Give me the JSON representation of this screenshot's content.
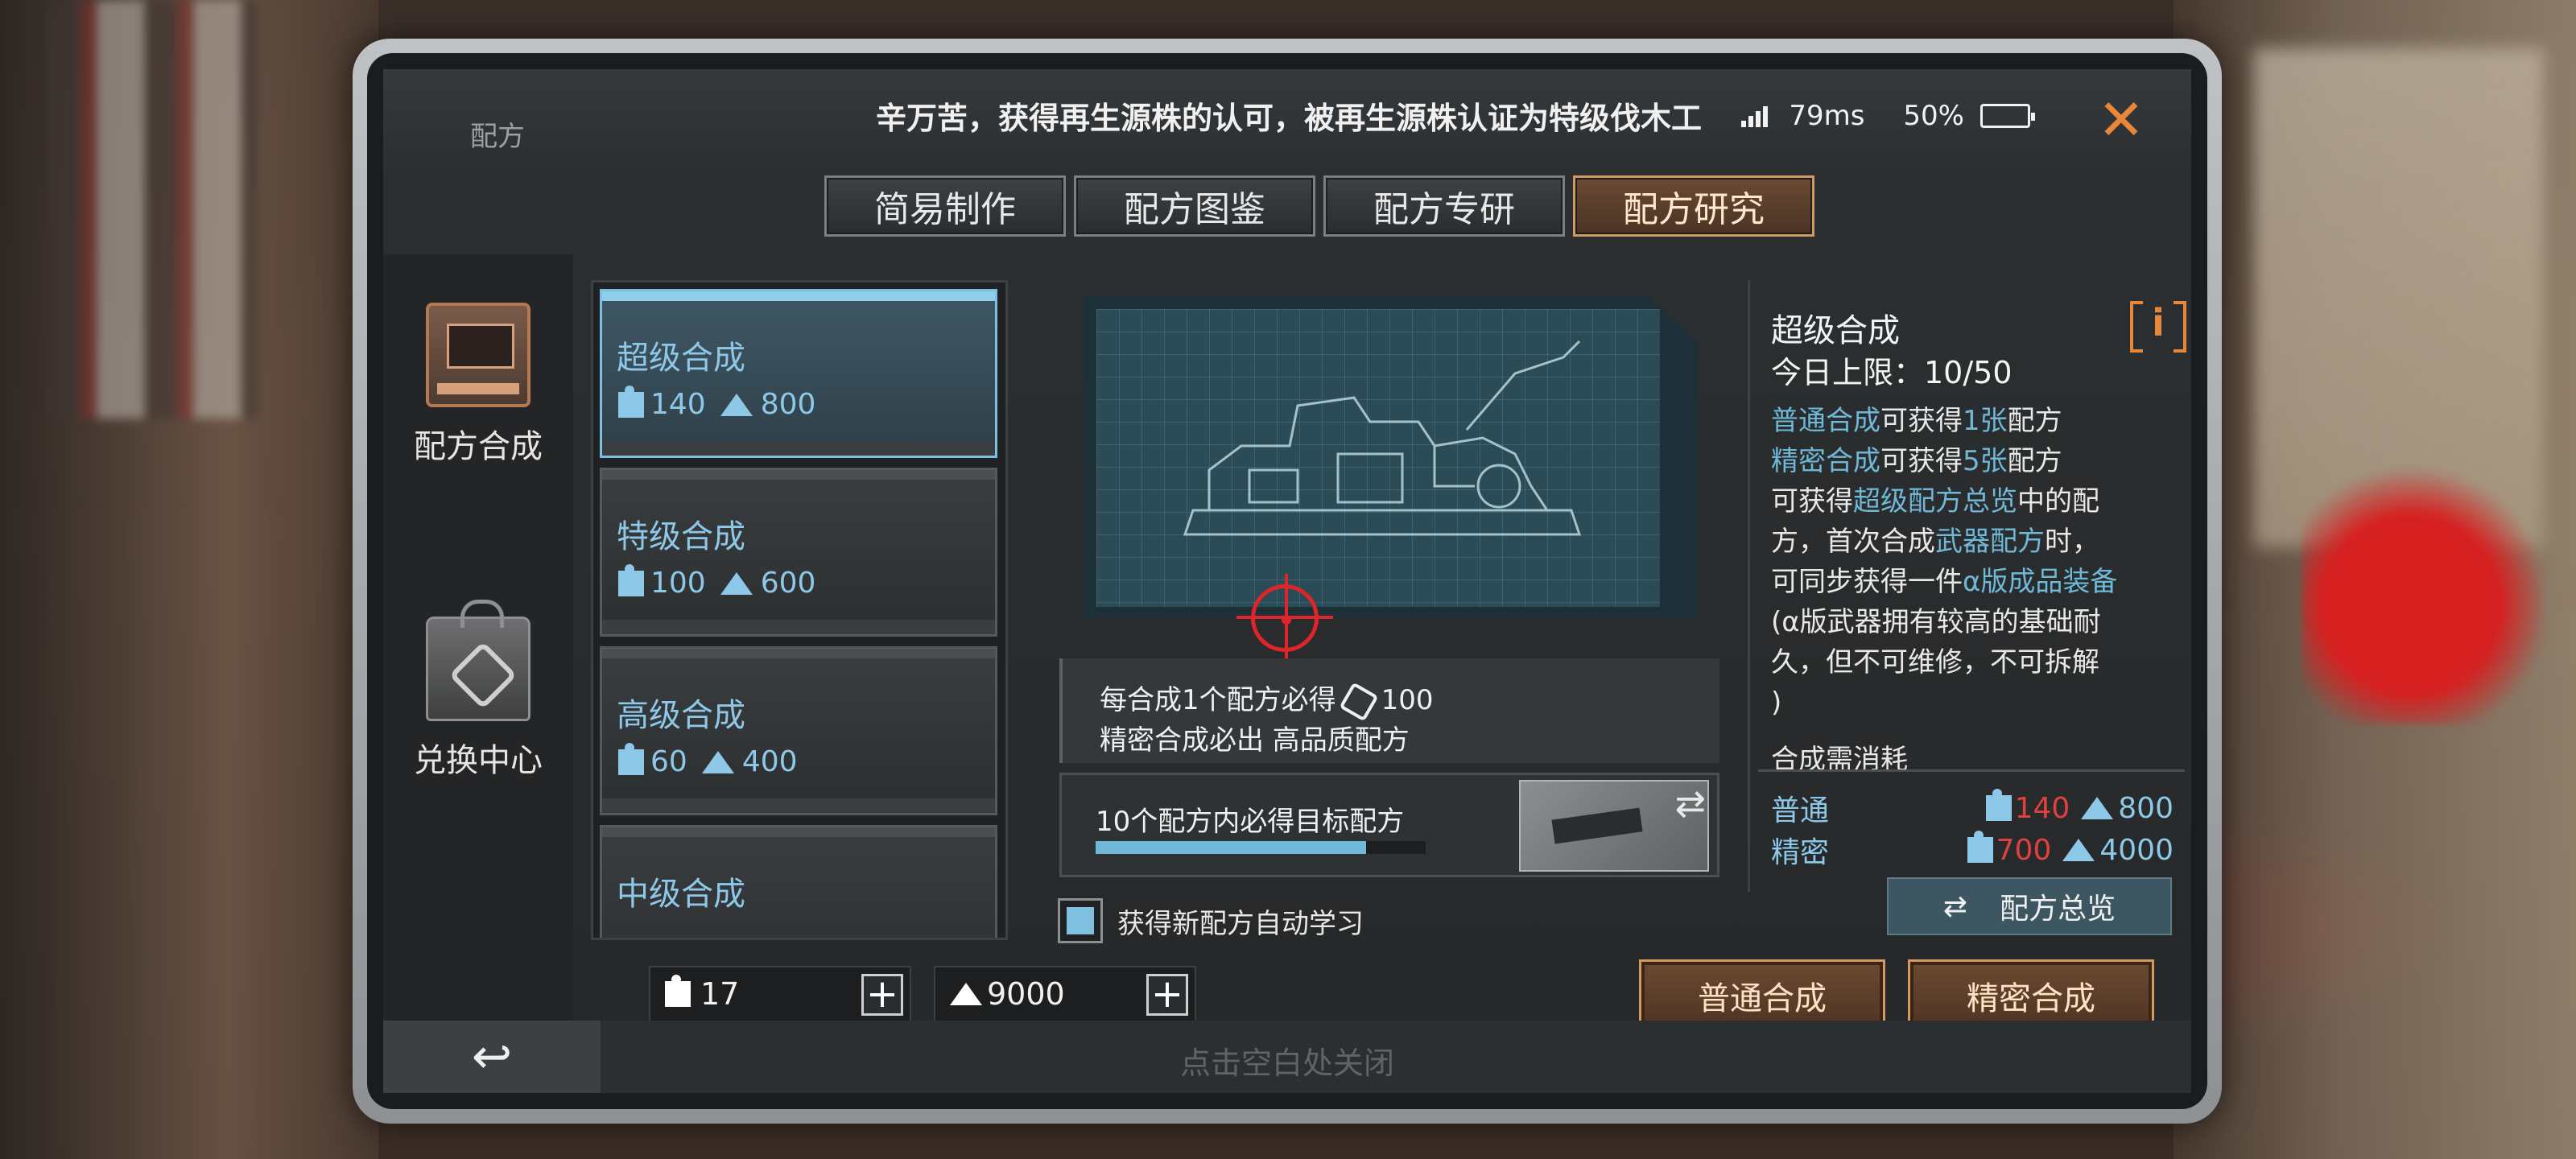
{
  "header": {
    "title": "配方",
    "marquee": "辛万苦，获得再生源株的认可，被再生源株认证为特级伐木工",
    "ping": "79ms",
    "battery": "50%",
    "battery_level": 0.5
  },
  "tabs": [
    {
      "label": "简易制作",
      "active": false
    },
    {
      "label": "配方图鉴",
      "active": false
    },
    {
      "label": "配方专研",
      "active": false
    },
    {
      "label": "配方研究",
      "active": true
    }
  ],
  "sidebar": {
    "items": [
      {
        "label": "配方合成",
        "icon": "terminal-icon"
      },
      {
        "label": "兑换中心",
        "icon": "shopping-bag-icon"
      }
    ]
  },
  "recipes": [
    {
      "name": "超级合成",
      "puzzle": "140",
      "ore": "800",
      "active": true
    },
    {
      "name": "特级合成",
      "puzzle": "100",
      "ore": "600",
      "active": false
    },
    {
      "name": "高级合成",
      "puzzle": "60",
      "ore": "400",
      "active": false
    },
    {
      "name": "中级合成",
      "puzzle": "",
      "ore": "",
      "active": false
    }
  ],
  "center": {
    "reward_line1_prefix": "每合成1个配方必得",
    "reward_line1_value": "100",
    "reward_line2": "精密合成必出 高品质配方",
    "target_text": "10个配方内必得目标配方",
    "target_progress": 0.82,
    "auto_learn_label": "获得新配方自动学习",
    "auto_learn_checked": true
  },
  "detail": {
    "title": "超级合成",
    "limit": "今日上限：10/50",
    "line1_a": "普通合成",
    "line1_b": "可获得",
    "line1_c": "1张",
    "line1_d": "配方",
    "line2_a": "精密合成",
    "line2_b": "可获得",
    "line2_c": "5张",
    "line2_d": "配方",
    "line3_a": "可获得",
    "line3_b": "超级配方总览",
    "line3_c": "中的配",
    "line4_a": "方，首次合成",
    "line4_b": "武器配方",
    "line4_c": "时，",
    "line5_a": "可同步获得一件",
    "line5_b": "α版成品装备",
    "line6": "(α版武器拥有较高的基础耐",
    "line7": "久，但不可维修，不可拆解",
    "line8": ")",
    "cost_label": "合成需消耗",
    "normal_label": "普通",
    "normal_puzzle": "140",
    "normal_ore": "800",
    "precise_label": "精密",
    "precise_puzzle": "700",
    "precise_ore": "4000"
  },
  "overview_button": "配方总览",
  "resources": {
    "puzzle": "17",
    "ore": "9000"
  },
  "actions": {
    "normal": "普通合成",
    "precise": "精密合成"
  },
  "footer": {
    "hint": "点击空白处关闭"
  },
  "colors": {
    "accent": "#d19a5e",
    "highlight": "#6fb8d8",
    "warning": "#e04040",
    "close": "#e8873a"
  }
}
